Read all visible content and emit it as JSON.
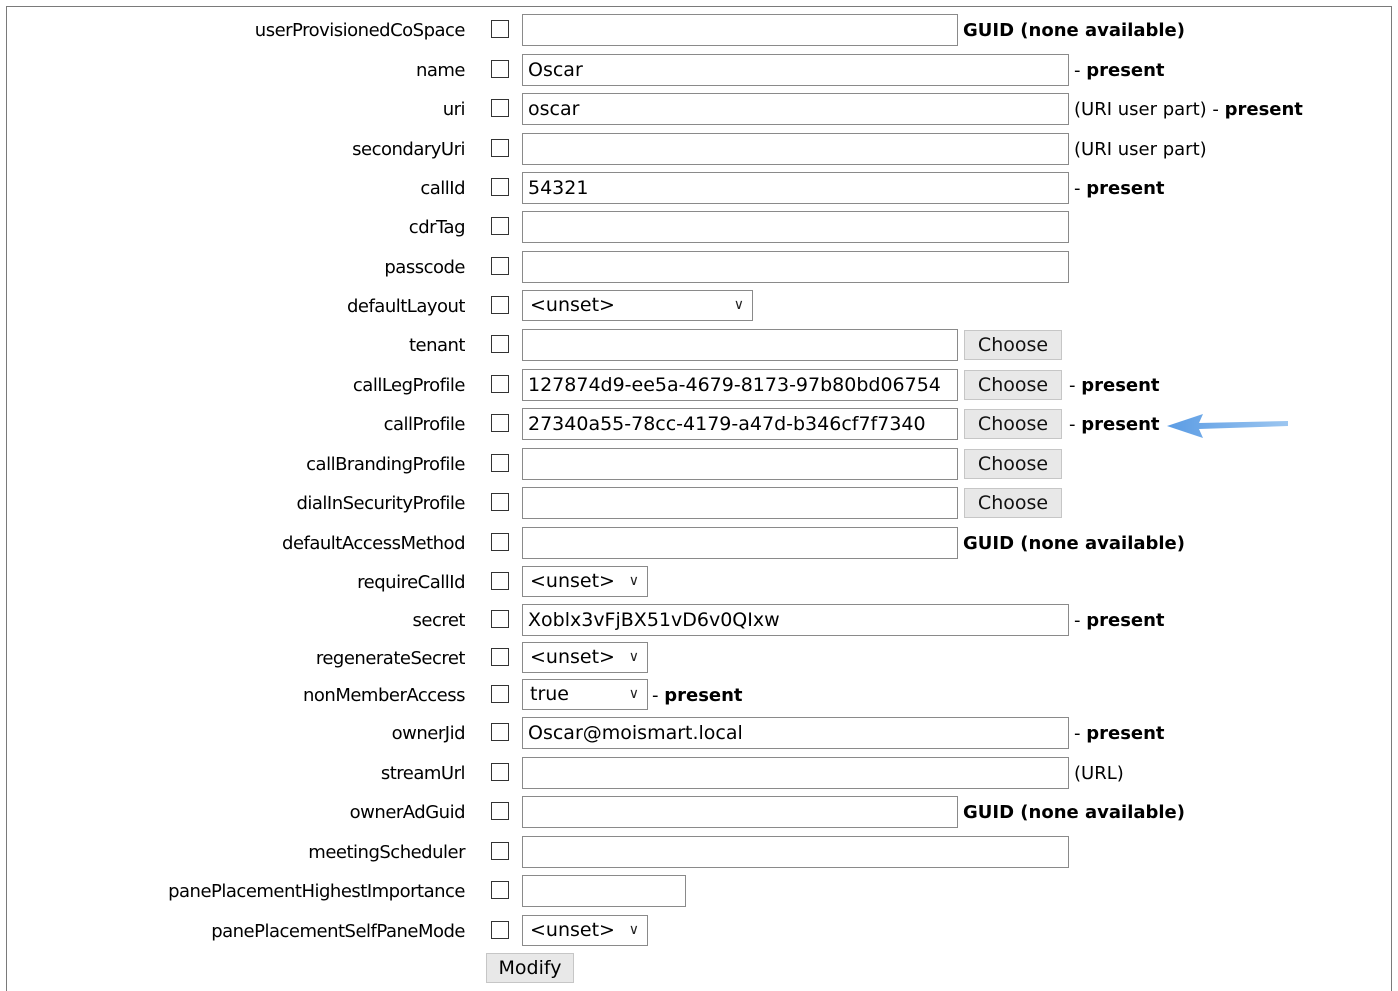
{
  "rows": [
    {
      "label": "userProvisionedCoSpace",
      "value": "",
      "note": "GUID (none available)"
    },
    {
      "label": "name",
      "value": "Oscar",
      "note_prefix": "- ",
      "note_bold": "present"
    },
    {
      "label": "uri",
      "value": "oscar",
      "note_plain": "(URI user part) - ",
      "note_bold": "present"
    },
    {
      "label": "secondaryUri",
      "value": "",
      "note_plain": "(URI user part)"
    },
    {
      "label": "callId",
      "value": "54321",
      "note_prefix": "- ",
      "note_bold": "present"
    },
    {
      "label": "cdrTag",
      "value": ""
    },
    {
      "label": "passcode",
      "value": ""
    },
    {
      "label": "defaultLayout",
      "selected": "<unset>"
    },
    {
      "label": "tenant",
      "value": "",
      "button": "Choose"
    },
    {
      "label": "callLegProfile",
      "value": "127874d9-ee5a-4679-8173-97b80bd06754",
      "button": "Choose",
      "note_prefix": "- ",
      "note_bold": "present"
    },
    {
      "label": "callProfile",
      "value": "27340a55-78cc-4179-a47d-b346cf7f7340",
      "button": "Choose",
      "note_prefix": "- ",
      "note_bold": "present"
    },
    {
      "label": "callBrandingProfile",
      "value": "",
      "button": "Choose"
    },
    {
      "label": "dialInSecurityProfile",
      "value": "",
      "button": "Choose"
    },
    {
      "label": "defaultAccessMethod",
      "value": "",
      "note": "GUID (none available)"
    },
    {
      "label": "requireCallId",
      "selected": "<unset>"
    },
    {
      "label": "secret",
      "value": "Xoblx3vFjBX51vD6v0QIxw",
      "note_prefix": "- ",
      "note_bold": "present"
    },
    {
      "label": "regenerateSecret",
      "selected": "<unset>"
    },
    {
      "label": "nonMemberAccess",
      "selected": "true",
      "note_prefix": "- ",
      "note_bold": "present"
    },
    {
      "label": "ownerJid",
      "value": "Oscar@moismart.local",
      "note_prefix": "- ",
      "note_bold": "present"
    },
    {
      "label": "streamUrl",
      "value": "",
      "note_plain": "(URL)"
    },
    {
      "label": "ownerAdGuid",
      "value": "",
      "note": "GUID (none available)"
    },
    {
      "label": "meetingScheduler",
      "value": ""
    },
    {
      "label": "panePlacementHighestImportance",
      "value": ""
    },
    {
      "label": "panePlacementSelfPaneMode",
      "selected": "<unset>"
    }
  ],
  "modify_label": "Modify",
  "colors": {
    "arrow": "#6aa6e6",
    "button_bg": "#e8e8e8"
  }
}
